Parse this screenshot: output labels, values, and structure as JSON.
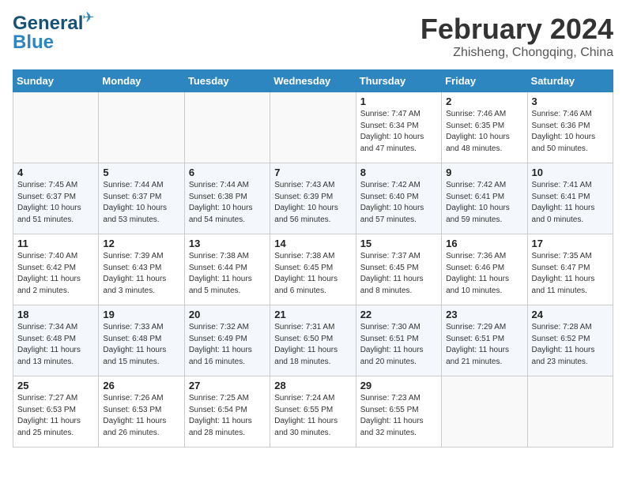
{
  "logo": {
    "line1": "General",
    "line2": "Blue"
  },
  "title": "February 2024",
  "location": "Zhisheng, Chongqing, China",
  "weekdays": [
    "Sunday",
    "Monday",
    "Tuesday",
    "Wednesday",
    "Thursday",
    "Friday",
    "Saturday"
  ],
  "weeks": [
    [
      {
        "day": "",
        "info": ""
      },
      {
        "day": "",
        "info": ""
      },
      {
        "day": "",
        "info": ""
      },
      {
        "day": "",
        "info": ""
      },
      {
        "day": "1",
        "info": "Sunrise: 7:47 AM\nSunset: 6:34 PM\nDaylight: 10 hours\nand 47 minutes."
      },
      {
        "day": "2",
        "info": "Sunrise: 7:46 AM\nSunset: 6:35 PM\nDaylight: 10 hours\nand 48 minutes."
      },
      {
        "day": "3",
        "info": "Sunrise: 7:46 AM\nSunset: 6:36 PM\nDaylight: 10 hours\nand 50 minutes."
      }
    ],
    [
      {
        "day": "4",
        "info": "Sunrise: 7:45 AM\nSunset: 6:37 PM\nDaylight: 10 hours\nand 51 minutes."
      },
      {
        "day": "5",
        "info": "Sunrise: 7:44 AM\nSunset: 6:37 PM\nDaylight: 10 hours\nand 53 minutes."
      },
      {
        "day": "6",
        "info": "Sunrise: 7:44 AM\nSunset: 6:38 PM\nDaylight: 10 hours\nand 54 minutes."
      },
      {
        "day": "7",
        "info": "Sunrise: 7:43 AM\nSunset: 6:39 PM\nDaylight: 10 hours\nand 56 minutes."
      },
      {
        "day": "8",
        "info": "Sunrise: 7:42 AM\nSunset: 6:40 PM\nDaylight: 10 hours\nand 57 minutes."
      },
      {
        "day": "9",
        "info": "Sunrise: 7:42 AM\nSunset: 6:41 PM\nDaylight: 10 hours\nand 59 minutes."
      },
      {
        "day": "10",
        "info": "Sunrise: 7:41 AM\nSunset: 6:41 PM\nDaylight: 11 hours\nand 0 minutes."
      }
    ],
    [
      {
        "day": "11",
        "info": "Sunrise: 7:40 AM\nSunset: 6:42 PM\nDaylight: 11 hours\nand 2 minutes."
      },
      {
        "day": "12",
        "info": "Sunrise: 7:39 AM\nSunset: 6:43 PM\nDaylight: 11 hours\nand 3 minutes."
      },
      {
        "day": "13",
        "info": "Sunrise: 7:38 AM\nSunset: 6:44 PM\nDaylight: 11 hours\nand 5 minutes."
      },
      {
        "day": "14",
        "info": "Sunrise: 7:38 AM\nSunset: 6:45 PM\nDaylight: 11 hours\nand 6 minutes."
      },
      {
        "day": "15",
        "info": "Sunrise: 7:37 AM\nSunset: 6:45 PM\nDaylight: 11 hours\nand 8 minutes."
      },
      {
        "day": "16",
        "info": "Sunrise: 7:36 AM\nSunset: 6:46 PM\nDaylight: 11 hours\nand 10 minutes."
      },
      {
        "day": "17",
        "info": "Sunrise: 7:35 AM\nSunset: 6:47 PM\nDaylight: 11 hours\nand 11 minutes."
      }
    ],
    [
      {
        "day": "18",
        "info": "Sunrise: 7:34 AM\nSunset: 6:48 PM\nDaylight: 11 hours\nand 13 minutes."
      },
      {
        "day": "19",
        "info": "Sunrise: 7:33 AM\nSunset: 6:48 PM\nDaylight: 11 hours\nand 15 minutes."
      },
      {
        "day": "20",
        "info": "Sunrise: 7:32 AM\nSunset: 6:49 PM\nDaylight: 11 hours\nand 16 minutes."
      },
      {
        "day": "21",
        "info": "Sunrise: 7:31 AM\nSunset: 6:50 PM\nDaylight: 11 hours\nand 18 minutes."
      },
      {
        "day": "22",
        "info": "Sunrise: 7:30 AM\nSunset: 6:51 PM\nDaylight: 11 hours\nand 20 minutes."
      },
      {
        "day": "23",
        "info": "Sunrise: 7:29 AM\nSunset: 6:51 PM\nDaylight: 11 hours\nand 21 minutes."
      },
      {
        "day": "24",
        "info": "Sunrise: 7:28 AM\nSunset: 6:52 PM\nDaylight: 11 hours\nand 23 minutes."
      }
    ],
    [
      {
        "day": "25",
        "info": "Sunrise: 7:27 AM\nSunset: 6:53 PM\nDaylight: 11 hours\nand 25 minutes."
      },
      {
        "day": "26",
        "info": "Sunrise: 7:26 AM\nSunset: 6:53 PM\nDaylight: 11 hours\nand 26 minutes."
      },
      {
        "day": "27",
        "info": "Sunrise: 7:25 AM\nSunset: 6:54 PM\nDaylight: 11 hours\nand 28 minutes."
      },
      {
        "day": "28",
        "info": "Sunrise: 7:24 AM\nSunset: 6:55 PM\nDaylight: 11 hours\nand 30 minutes."
      },
      {
        "day": "29",
        "info": "Sunrise: 7:23 AM\nSunset: 6:55 PM\nDaylight: 11 hours\nand 32 minutes."
      },
      {
        "day": "",
        "info": ""
      },
      {
        "day": "",
        "info": ""
      }
    ]
  ]
}
